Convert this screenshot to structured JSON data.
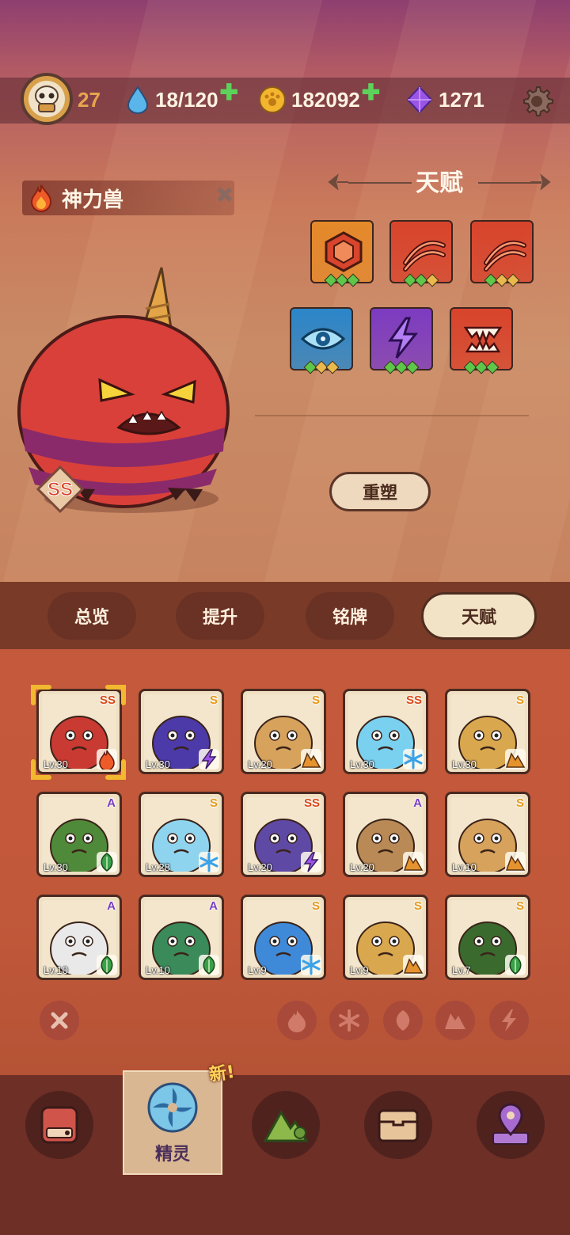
{
  "player": {
    "level": "27"
  },
  "resources": {
    "energy": "18/120",
    "coins": "182092",
    "gems": "1271"
  },
  "creature": {
    "name": "神力兽",
    "rank": "SS"
  },
  "talent": {
    "title": "天赋",
    "reshape_label": "重塑",
    "icons": [
      {
        "name": "hexagon-gem-icon",
        "color": "#e5892a",
        "dots": [
          "g",
          "g",
          "g"
        ]
      },
      {
        "name": "claw-slash-icon",
        "color": "#d8442c",
        "dots": [
          "g",
          "g",
          "y"
        ]
      },
      {
        "name": "claw-slash-icon",
        "color": "#d8442c",
        "dots": [
          "g",
          "y",
          "y"
        ]
      },
      {
        "name": "eye-icon",
        "color": "#2b86c9",
        "dots": [
          "g",
          "y",
          "y"
        ]
      },
      {
        "name": "lightning-icon",
        "color": "#7c3bc1",
        "dots": [
          "g",
          "g",
          "g"
        ]
      },
      {
        "name": "fangs-icon",
        "color": "#d8442c",
        "dots": [
          "g",
          "g",
          "g"
        ]
      }
    ]
  },
  "tabs": [
    "总览",
    "提升",
    "铭牌",
    "天赋"
  ],
  "active_tab": "天赋",
  "pets": [
    {
      "rank": "SS",
      "lv": "Lv.30",
      "element": "fire",
      "color": "#c93a32"
    },
    {
      "rank": "S",
      "lv": "Lv.30",
      "element": "lightning",
      "color": "#4b3aa8"
    },
    {
      "rank": "S",
      "lv": "Lv.20",
      "element": "earth",
      "color": "#d6a25c"
    },
    {
      "rank": "SS",
      "lv": "Lv.30",
      "element": "ice",
      "color": "#7ad0ef"
    },
    {
      "rank": "S",
      "lv": "Lv.30",
      "element": "earth",
      "color": "#d9a84e"
    },
    {
      "rank": "A",
      "lv": "Lv.30",
      "element": "leaf",
      "color": "#4f8a3a"
    },
    {
      "rank": "S",
      "lv": "Lv.28",
      "element": "ice",
      "color": "#8fd4ef"
    },
    {
      "rank": "SS",
      "lv": "Lv.20",
      "element": "lightning",
      "color": "#5e4aa4"
    },
    {
      "rank": "A",
      "lv": "Lv.20",
      "element": "earth",
      "color": "#b98a55"
    },
    {
      "rank": "S",
      "lv": "Lv.10",
      "element": "earth",
      "color": "#d6a25c"
    },
    {
      "rank": "A",
      "lv": "Lv.10",
      "element": "leaf",
      "color": "#e9e9e9"
    },
    {
      "rank": "A",
      "lv": "Lv.10",
      "element": "leaf",
      "color": "#3a8a5a"
    },
    {
      "rank": "S",
      "lv": "Lv.9",
      "element": "ice",
      "color": "#3f8ad8"
    },
    {
      "rank": "S",
      "lv": "Lv.9",
      "element": "earth",
      "color": "#d9a84e"
    },
    {
      "rank": "S",
      "lv": "Lv.7",
      "element": "leaf",
      "color": "#3a6a2e"
    }
  ],
  "filters": [
    "fire",
    "ice",
    "leaf",
    "earth",
    "lightning"
  ],
  "nav": {
    "active_label": "精灵",
    "new_badge": "新!",
    "items": [
      "bag-icon",
      "spirit-icon",
      "mountain-icon",
      "chest-icon",
      "map-pin-icon"
    ]
  },
  "colors": {
    "accent": "#e9a54a",
    "tab_active": "#f3e3c6",
    "tab_inactive": "#6a3224"
  }
}
